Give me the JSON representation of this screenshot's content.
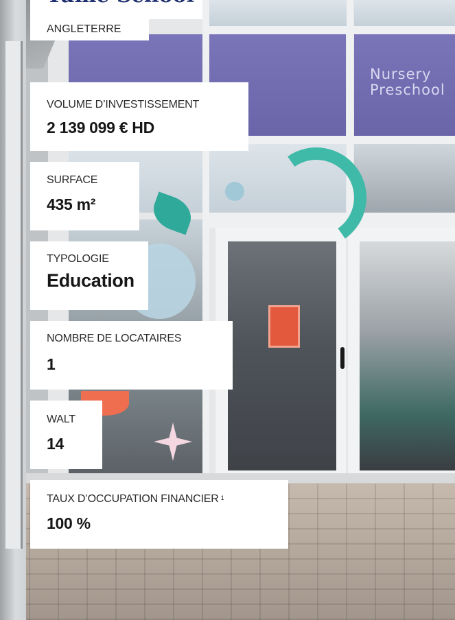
{
  "property": {
    "name": "Yume School",
    "country": "ANGLETERRE"
  },
  "storefront": {
    "sign_line1": "Nursery",
    "sign_line2": "Preschool"
  },
  "stats": [
    {
      "label": "VOLUME D’INVESTISSEMENT",
      "value": "2 139 099 € HD"
    },
    {
      "label": "SURFACE",
      "value": "435 m²"
    },
    {
      "label": "TYPOLOGIE",
      "value": "Education"
    },
    {
      "label": "NOMBRE DE LOCATAIRES",
      "value": "1"
    },
    {
      "label": "WALT",
      "value": "14"
    },
    {
      "label": "TAUX D’OCCUPATION FINANCIER",
      "footnote": "1",
      "value": "100 %"
    }
  ]
}
